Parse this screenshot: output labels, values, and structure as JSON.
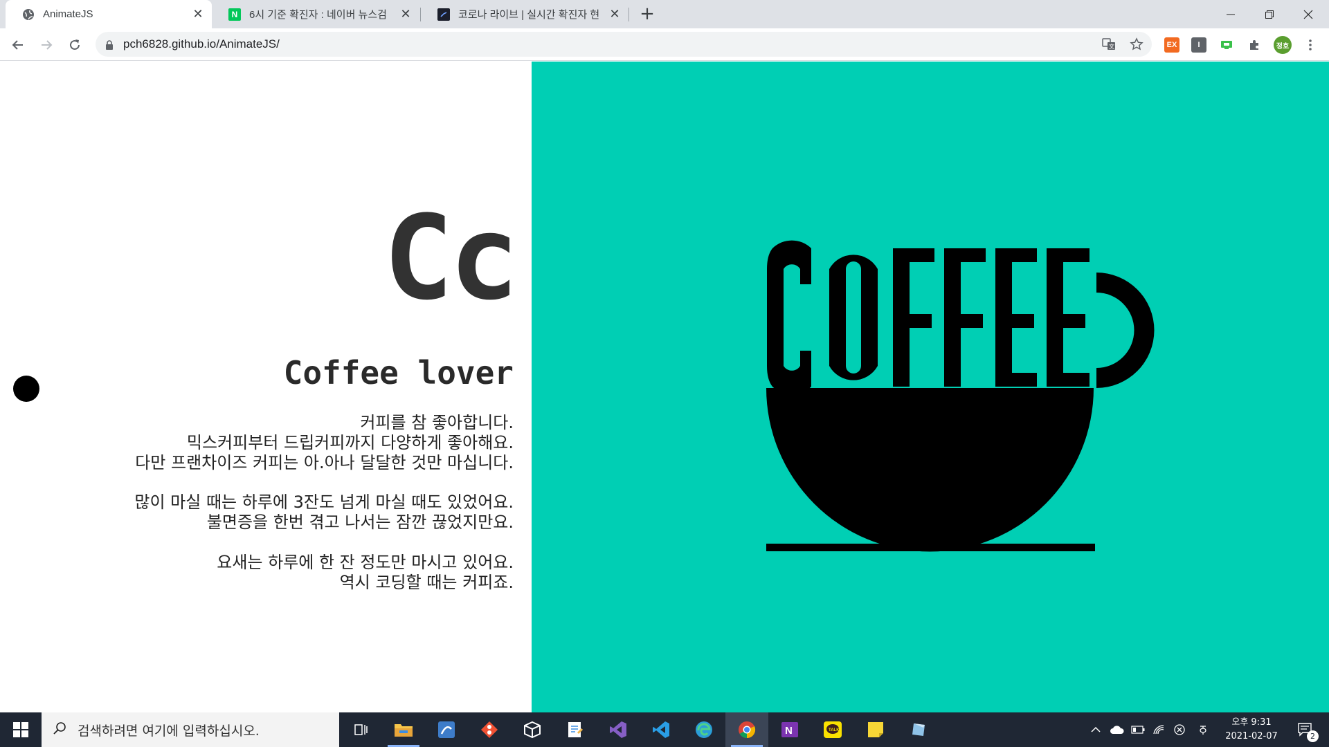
{
  "browser": {
    "tabs": [
      {
        "title": "AnimateJS",
        "active": true
      },
      {
        "title": "6시 기준 확진자 : 네이버 뉴스검",
        "active": false
      },
      {
        "title": "코로나 라이브 | 실시간 확진자 현",
        "active": false
      }
    ],
    "new_tab_label": "+",
    "address": "pch6828.github.io/AnimateJS/",
    "profile_initials": "정호",
    "extensions": [
      "EX",
      "I"
    ]
  },
  "page": {
    "big_letters": "Cc",
    "subtitle": "Coffee lover",
    "paragraphs": [
      [
        "커피를 참 좋아합니다.",
        "믹스커피부터 드립커피까지 다양하게 좋아해요.",
        "다만 프랜차이즈 커피는 아.아나 달달한 것만 마십니다."
      ],
      [
        "많이 마실 때는 하루에 3잔도 넘게 마실 때도 있었어요.",
        "불면증을 한번 겪고 나서는 잠깐 끊었지만요."
      ],
      [
        "요새는 하루에 한 잔 정도만 마시고 있어요.",
        "역시 코딩할 때는 커피죠."
      ]
    ],
    "accent_color": "#00cfb4"
  },
  "taskbar": {
    "search_placeholder": "검색하려면 여기에 입력하십시오.",
    "time": "오후 9:31",
    "date": "2021-02-07",
    "notification_count": "2"
  }
}
